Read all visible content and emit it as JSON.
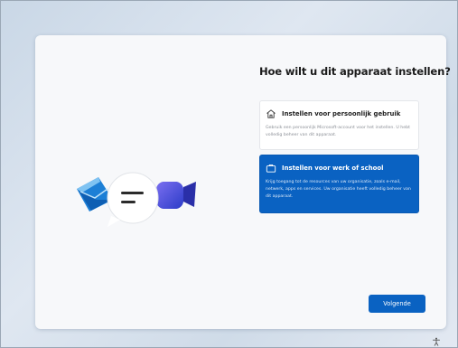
{
  "setup": {
    "title": "Hoe wilt u dit apparaat instellen?",
    "options": [
      {
        "title": "Instellen voor persoonlijk gebruik",
        "description": "Gebruik een persoonlijk Microsoft-account voor het instellen. U hebt volledig beheer van dit apparaat.",
        "icon": "home-icon",
        "selected": false
      },
      {
        "title": "Instellen voor werk of school",
        "description": "Krijg toegang tot de resources van uw organisatie, zoals e-mail, netwerk, apps en services. Uw organisatie heeft volledig beheer van dit apparaat.",
        "icon": "briefcase-icon",
        "selected": true
      }
    ],
    "next_label": "Volgende"
  },
  "colors": {
    "accent": "#0a62c2",
    "card": "#f7f8fa"
  },
  "icons": [
    "mail-icon",
    "chat-bubble-icon",
    "video-camera-icon",
    "home-icon",
    "briefcase-icon",
    "accessibility-icon"
  ]
}
